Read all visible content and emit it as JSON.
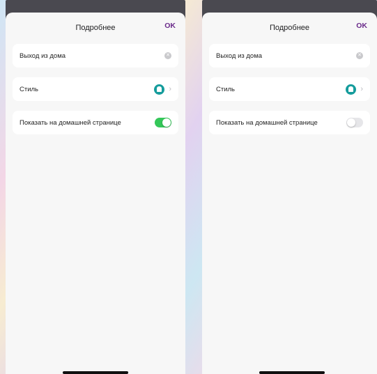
{
  "screens": [
    {
      "nav": {
        "title": "Подробнее",
        "ok_label": "OK"
      },
      "name_field": {
        "value": "Выход из дома"
      },
      "style_row": {
        "label": "Стиль",
        "icon": "home-icon"
      },
      "home_toggle_row": {
        "label": "Показать на домашней странице",
        "enabled": true
      }
    },
    {
      "nav": {
        "title": "Подробнее",
        "ok_label": "OK"
      },
      "name_field": {
        "value": "Выход из дома"
      },
      "style_row": {
        "label": "Стиль",
        "icon": "home-icon"
      },
      "home_toggle_row": {
        "label": "Показать на домашней странице",
        "enabled": false
      }
    }
  ],
  "colors": {
    "accent_ok": "#6a2a8a",
    "toggle_on": "#34c759",
    "toggle_off": "#e6e6e9",
    "style_badge": "#159c9c"
  }
}
